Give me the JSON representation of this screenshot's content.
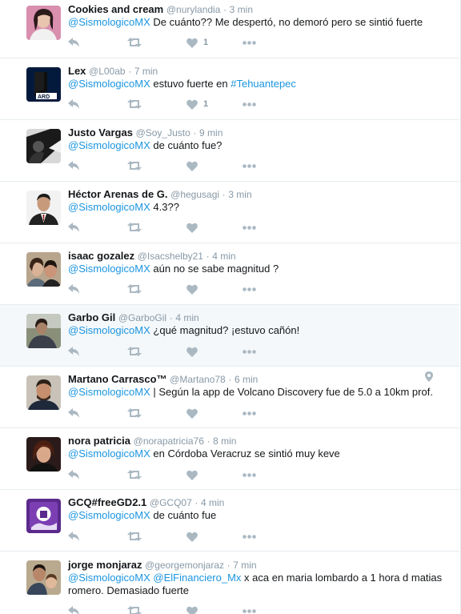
{
  "tweets": [
    {
      "name": "Cookies and cream",
      "handle": "@nurylandia",
      "time": "3 min",
      "parts": [
        {
          "t": "@SismologicoMX",
          "m": true
        },
        {
          "t": " De cuánto?? Me despertó, no demoró pero se sintió fuerte",
          "m": false
        }
      ],
      "likes": "1",
      "avatar": "avatar-woman-pink"
    },
    {
      "name": "Lex",
      "handle": "@L00ab",
      "time": "7 min",
      "parts": [
        {
          "t": "@SismologicoMX",
          "m": true
        },
        {
          "t": " estuvo fuerte en ",
          "m": false
        },
        {
          "t": "#Tehuantepec",
          "m": true
        }
      ],
      "likes": "1",
      "avatar": "avatar-ard-logo"
    },
    {
      "name": "Justo Vargas",
      "handle": "@Soy_Justo",
      "time": "9 min",
      "parts": [
        {
          "t": "@SismologicoMX",
          "m": true
        },
        {
          "t": " de cuánto fue?",
          "m": false
        }
      ],
      "likes": "",
      "avatar": "avatar-bw-photo"
    },
    {
      "name": "Héctor Arenas de G.",
      "handle": "@hegusagi",
      "time": "3 min",
      "parts": [
        {
          "t": "@SismologicoMX",
          "m": true
        },
        {
          "t": " 4.3??",
          "m": false
        }
      ],
      "likes": "",
      "avatar": "avatar-man-suit"
    },
    {
      "name": "isaac gozalez",
      "handle": "@Isacshelby21",
      "time": "4 min",
      "parts": [
        {
          "t": "@SismologicoMX",
          "m": true
        },
        {
          "t": " aún no se sabe magnitud ?",
          "m": false
        }
      ],
      "likes": "",
      "avatar": "avatar-couple"
    },
    {
      "name": "Garbo Gil",
      "handle": "@GarboGil",
      "time": "4 min",
      "parts": [
        {
          "t": "@SismologicoMX",
          "m": true
        },
        {
          "t": " ¿qué magnitud? ¡estuvo cañón!",
          "m": false
        }
      ],
      "likes": "",
      "avatar": "avatar-man-outdoor"
    },
    {
      "name": "Martano Carrasco™",
      "handle": "@Martano78",
      "time": "6 min",
      "parts": [
        {
          "t": "@SismologicoMX",
          "m": true
        },
        {
          "t": " | Según la app de Volcano Discovery fue de 5.0 a 10km prof.",
          "m": false
        }
      ],
      "likes": "",
      "avatar": "avatar-man-beard",
      "geo": true
    },
    {
      "name": "nora patricia",
      "handle": "@norapatricia76",
      "time": "8 min",
      "parts": [
        {
          "t": "@SismologicoMX",
          "m": true
        },
        {
          "t": " en Córdoba Veracruz se sintió muy keve",
          "m": false
        }
      ],
      "likes": "",
      "avatar": "avatar-woman-red"
    },
    {
      "name": "GCQ#freeGD2.1",
      "handle": "@GCQ07",
      "time": "4 min",
      "parts": [
        {
          "t": "@SismologicoMX",
          "m": true
        },
        {
          "t": " de cuánto fue",
          "m": false
        }
      ],
      "likes": "",
      "avatar": "avatar-purple-logo"
    },
    {
      "name": "jorge monjaraz",
      "handle": "@georgemonjaraz",
      "time": "7 min",
      "parts": [
        {
          "t": "@SismologicoMX",
          "m": true
        },
        {
          "t": " ",
          "m": false
        },
        {
          "t": "@ElFinanciero_Mx",
          "m": true
        },
        {
          "t": " x aca en maria lombardo a 1 hora d matias romero. Demasiado fuerte",
          "m": false
        }
      ],
      "likes": "",
      "avatar": "avatar-man-child"
    }
  ],
  "colors": {
    "mention": "#1b95e0",
    "muted": "#8899a6",
    "icon": "#aab8c2",
    "highlight": "#f5f8fa"
  }
}
